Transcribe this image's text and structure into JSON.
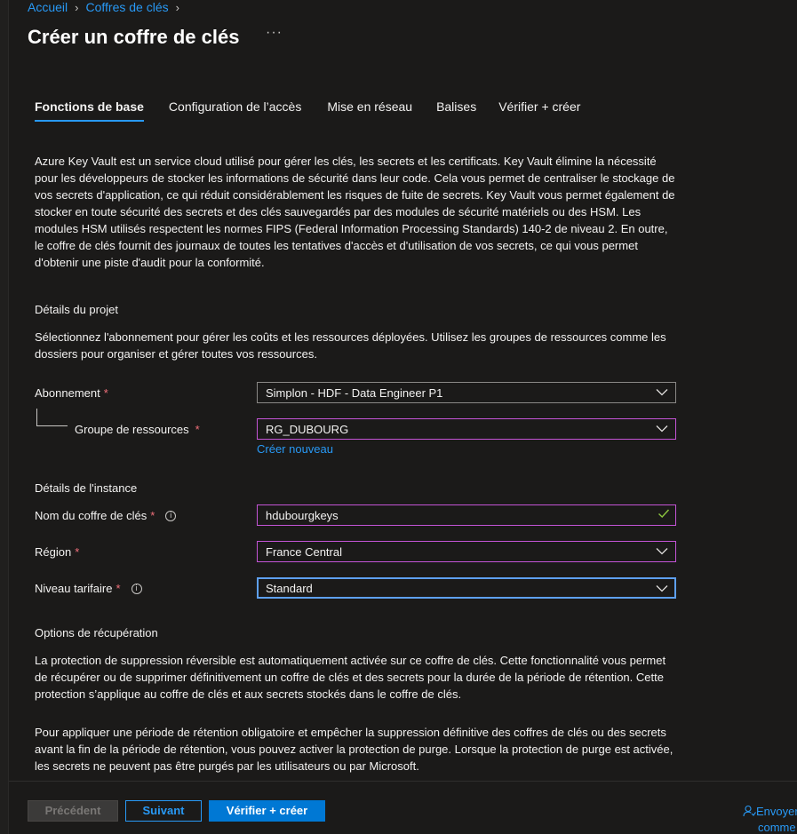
{
  "breadcrumb": {
    "home": "Accueil",
    "parent": "Coffres de clés",
    "sep1": "›",
    "sep2": "›"
  },
  "page": {
    "title": "Créer un coffre de clés",
    "more": "···"
  },
  "tabs": [
    {
      "label": "Fonctions de base",
      "active": true
    },
    {
      "label": "Configuration de l’accès",
      "active": false
    },
    {
      "label": "Mise en réseau",
      "active": false
    },
    {
      "label": "Balises",
      "active": false
    },
    {
      "label": "Vérifier + créer",
      "active": false
    }
  ],
  "intro": "Azure Key Vault est un service cloud utilisé pour gérer les clés, les secrets et les certificats. Key Vault élimine la nécessité pour les développeurs de stocker les informations de sécurité dans leur code. Cela vous permet de centraliser le stockage de vos secrets d'application, ce qui réduit considérablement les risques de fuite de secrets. Key Vault vous permet également de stocker en toute sécurité des secrets et des clés sauvegardés par des modules de sécurité matériels ou des HSM. Les modules HSM utilisés respectent les normes FIPS (Federal Information Processing Standards) 140-2 de niveau 2. En outre, le coffre de clés fournit des journaux de toutes les tentatives d'accès et d'utilisation de vos secrets, ce qui vous permet d'obtenir une piste d'audit pour la conformité.",
  "project": {
    "heading": "Détails du projet",
    "desc": "Sélectionnez l'abonnement pour gérer les coûts et les ressources déployées. Utilisez les groupes de ressources comme les dossiers pour organiser et gérer toutes vos ressources.",
    "subscription_label": "Abonnement",
    "subscription_value": "Simplon - HDF - Data Engineer P1",
    "rg_label": "Groupe de ressources",
    "rg_value": "RG_DUBOURG",
    "create_new": "Créer nouveau"
  },
  "instance": {
    "heading": "Détails de l'instance",
    "name_label": "Nom du coffre de clés",
    "name_value": "hdubourgkeys",
    "region_label": "Région",
    "region_value": "France Central",
    "tier_label": "Niveau tarifaire",
    "tier_value": "Standard"
  },
  "recovery": {
    "heading": "Options de récupération",
    "p1": "La protection de suppression réversible est automatiquement activée sur ce coffre de clés. Cette fonctionnalité vous permet de récupérer ou de supprimer définitivement un coffre de clés et des secrets pour la durée de la période de rétention. Cette protection s’applique au coffre de clés et aux secrets stockés dans le coffre de clés.",
    "p2": "Pour appliquer une période de rétention obligatoire et empêcher la suppression définitive des coffres de clés ou des secrets avant la fin de la période de rétention, vous pouvez activer la protection de purge. Lorsque la protection de purge est activée, les secrets ne peuvent pas être purgés par les utilisateurs ou par Microsoft."
  },
  "required_mark": "*",
  "info_glyph": "i",
  "footer": {
    "prev": "Précédent",
    "next": "Suivant",
    "create": "Vérifier + créer",
    "feedback_line1": "Envoyer",
    "feedback_line2": "comme"
  },
  "colors": {
    "background": "#1b1a19",
    "accent": "#2899f5",
    "primary_button": "#0078d4",
    "required": "#f1707b",
    "field_focus": "#c454d6",
    "valid_check": "#8dc63f"
  },
  "icons": [
    "chevron-right-icon",
    "more-icon",
    "chevron-down-icon",
    "checkmark-icon",
    "info-icon",
    "feedback-icon"
  ]
}
